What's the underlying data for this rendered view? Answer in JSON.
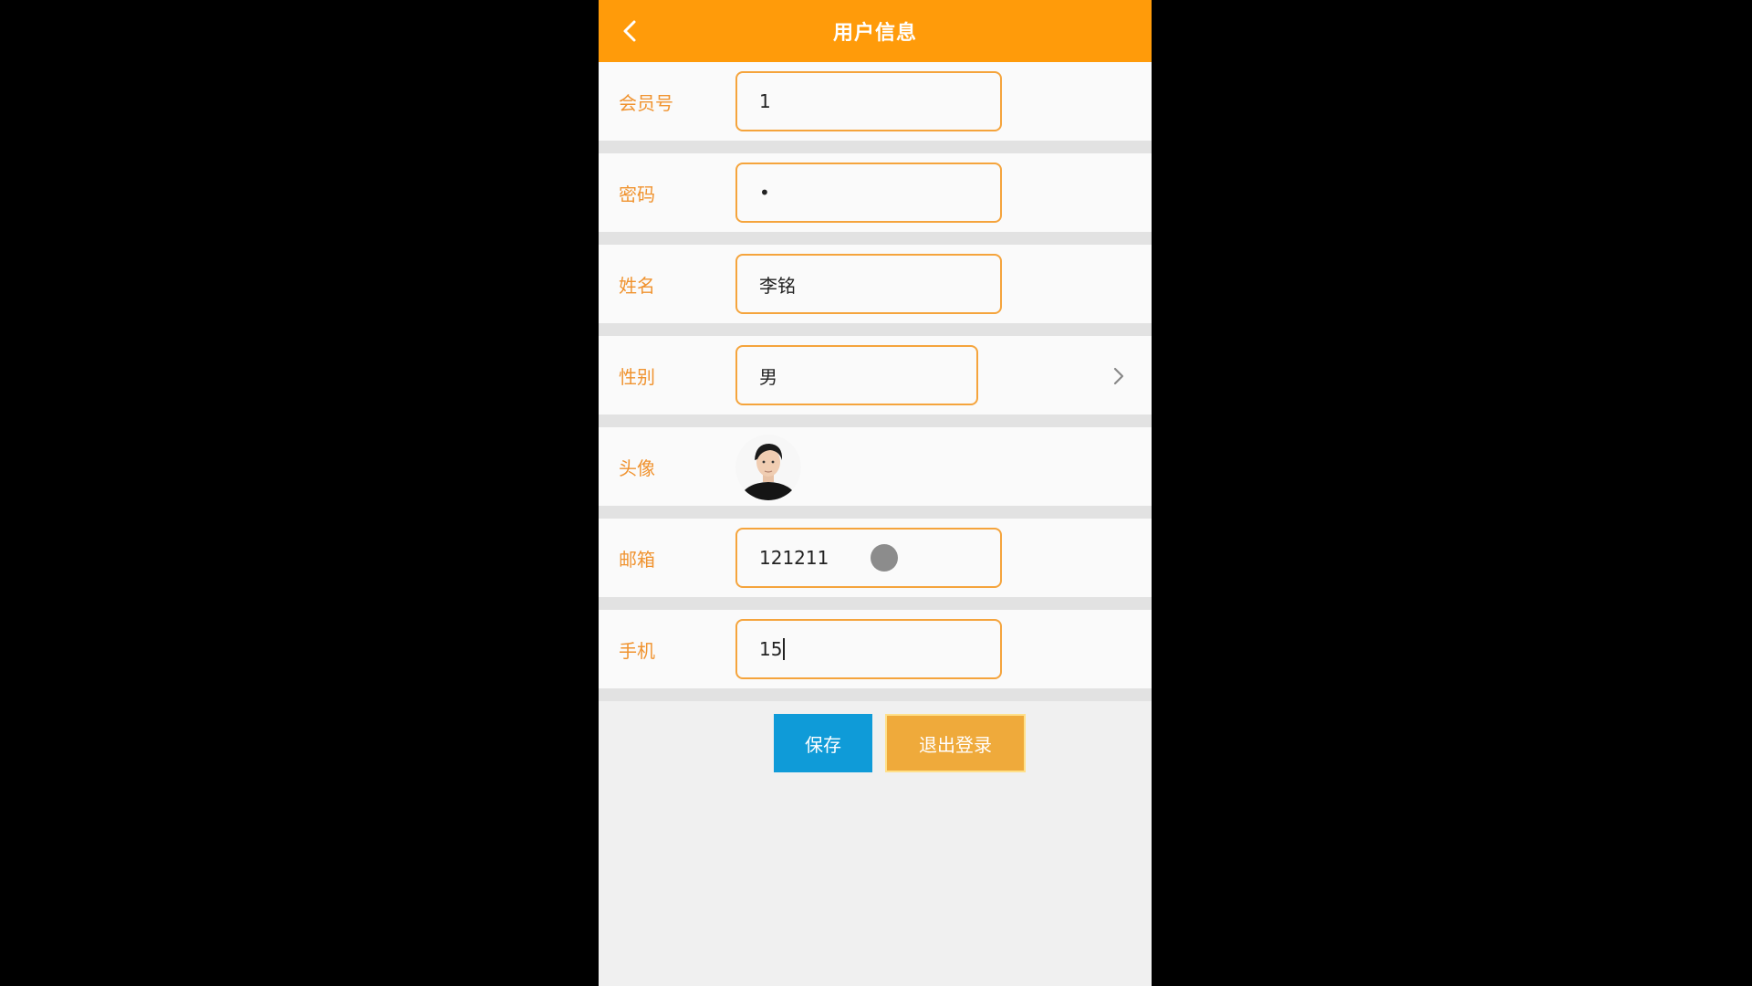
{
  "header": {
    "title": "用户信息",
    "back_icon": "chevron-left-icon"
  },
  "form": {
    "member_no": {
      "label": "会员号",
      "value": "1"
    },
    "password": {
      "label": "密码",
      "value": "•"
    },
    "name": {
      "label": "姓名",
      "value": "李铭"
    },
    "gender": {
      "label": "性别",
      "value": "男",
      "icon": "chevron-right-icon"
    },
    "avatar": {
      "label": "头像"
    },
    "email": {
      "label": "邮箱",
      "value": "121211"
    },
    "phone": {
      "label": "手机",
      "value": "15"
    }
  },
  "buttons": {
    "save": "保存",
    "logout": "退出登录"
  },
  "colors": {
    "header_bg": "#ff9b0a",
    "label": "#f0932f",
    "save_bg": "#0f9bd8",
    "logout_bg": "#efaa3b"
  }
}
